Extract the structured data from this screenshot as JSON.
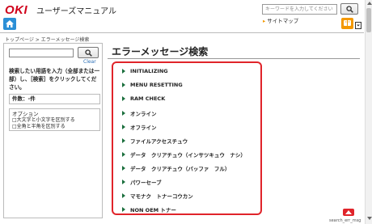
{
  "header": {
    "logo": "OKI",
    "app_title": "ユーザーズマニュアル",
    "search_placeholder": "キーワードを入力してください",
    "sitemap_label": "サイトマップ"
  },
  "breadcrumb": "トップページ > エラーメッセージ検索",
  "sidebar": {
    "clear_label": "Clear",
    "instruction": "検索したい用語を入力（全部または一部）し、［検索］をクリックしてください。",
    "count_label": "件数：-件",
    "options_title": "オプション",
    "option_case": "□大文字と小文字を区別する",
    "option_width": "□全角と半角を区別する"
  },
  "main": {
    "title": "エラーメッセージ検索",
    "items": [
      "INITIALIZING",
      "MENU RESETTING",
      "RAM CHECK",
      "オンライン",
      "オフライン",
      "ファイルアクセスチュウ",
      "データ　クリアチュウ（インサツキュウ　ナシ）",
      "データ　クリアチュウ（バッファ　フル）",
      "パワーセーブ",
      "マモナク　トナーコウカン",
      "NON OEM トナー"
    ]
  },
  "footer": {
    "page_id": "search_err_msg"
  },
  "colors": {
    "brand_red": "#d0021b",
    "panel_border": "#e0242a",
    "bullet": "#1b6f3d",
    "home_blue": "#2b8fd6",
    "help_orange": "#f39800"
  },
  "icons": [
    "home-icon",
    "search-icon",
    "help-icon",
    "print-icon",
    "chevron-up-icon"
  ]
}
